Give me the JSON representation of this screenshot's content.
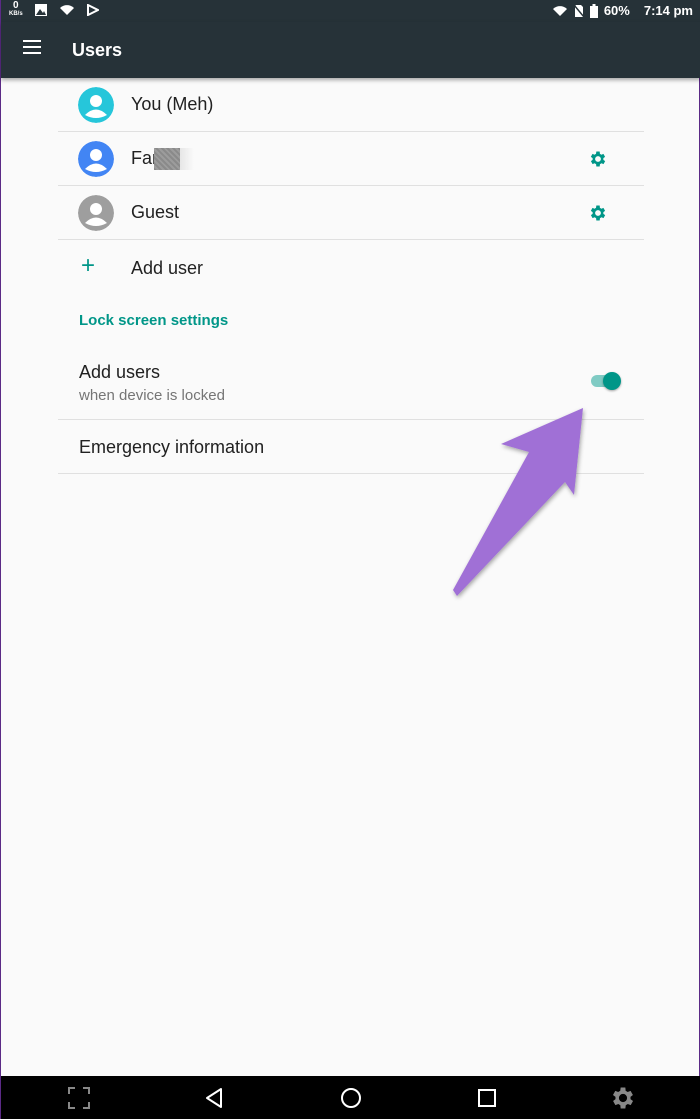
{
  "status_bar": {
    "net_speed": "0",
    "net_unit": "KB/s",
    "battery": "60%",
    "time": "7:14 pm"
  },
  "app_bar": {
    "title": "Users",
    "menu_icon": "menu-icon"
  },
  "users": [
    {
      "name": "You (Meh)",
      "avatar_color": "#26c6da",
      "settings": false
    },
    {
      "name": "Far",
      "avatar_color": "#4285f4",
      "settings": true,
      "redacted": true
    },
    {
      "name": "Guest",
      "avatar_color": "#9e9e9e",
      "settings": true
    }
  ],
  "add_user": {
    "label": "Add user",
    "icon": "plus-icon"
  },
  "lock_screen": {
    "header": "Lock screen settings",
    "add_users_title": "Add users",
    "add_users_subtitle": "when device is locked",
    "add_users_enabled": true
  },
  "emergency": {
    "label": "Emergency information"
  },
  "colors": {
    "accent": "#009688",
    "app_bar": "#263238",
    "annotation_arrow": "#a070d6"
  },
  "nav_bar": {
    "icons": [
      "screenshot-frame-icon",
      "back-icon",
      "home-icon",
      "recents-icon",
      "settings-gear-icon"
    ]
  }
}
